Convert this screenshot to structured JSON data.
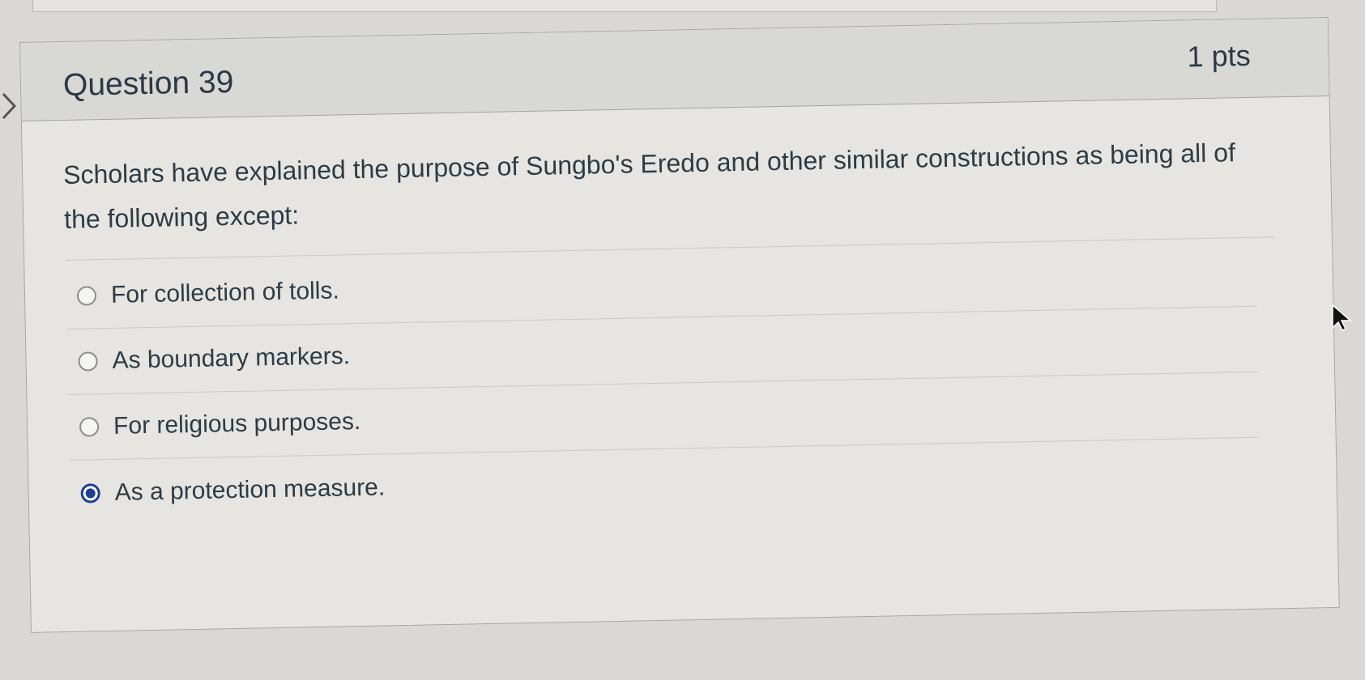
{
  "question": {
    "title": "Question 39",
    "points": "1 pts",
    "text": "Scholars have explained the purpose of Sungbo's Eredo and other similar constructions as being all of the following except:"
  },
  "answers": [
    {
      "label": "For collection of tolls.",
      "selected": false
    },
    {
      "label": "As boundary markers.",
      "selected": false
    },
    {
      "label": "For religious purposes.",
      "selected": false
    },
    {
      "label": "As a protection measure.",
      "selected": true
    }
  ],
  "icons": {
    "left_nav": "chevron-right-icon",
    "pointer": "mouse-cursor-icon"
  },
  "colors": {
    "selected_radio": "#1f3f8f",
    "text": "#2d3b45",
    "header_bg": "#d8d8d5",
    "card_bg": "#e6e5e1"
  }
}
